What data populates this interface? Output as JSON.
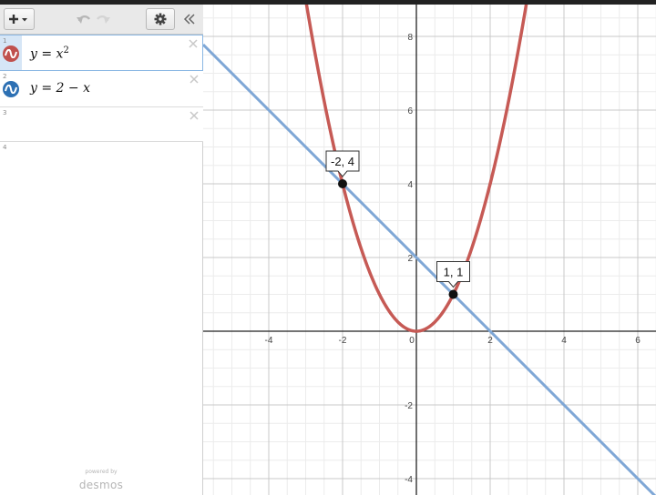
{
  "app": {
    "brand_small": "powered by",
    "brand": "desmos"
  },
  "toolbar": {
    "add_icon": "plus-dropdown-icon",
    "undo_icon": "undo-icon",
    "redo_icon": "redo-icon",
    "settings_icon": "gear-icon",
    "collapse_icon": "double-chevron-left-icon"
  },
  "expressions": [
    {
      "num": "1",
      "color": "#c0504d",
      "lhs": "y = x",
      "sup": "2",
      "active": true
    },
    {
      "num": "2",
      "color": "#2d70b3",
      "lhs": "y = 2 − x",
      "sup": "",
      "active": false
    },
    {
      "num": "3",
      "color": "",
      "lhs": "",
      "sup": "",
      "active": false
    },
    {
      "num": "4",
      "color": "",
      "lhs": "",
      "sup": "",
      "active": false
    }
  ],
  "graph": {
    "x_ticks": [
      "-4",
      "-2",
      "0",
      "2",
      "4",
      "6"
    ],
    "y_ticks": [
      "8",
      "6",
      "4",
      "2",
      "-2",
      "-4"
    ],
    "x_tick_values": [
      -4,
      -2,
      0,
      2,
      4,
      6
    ],
    "y_tick_values": [
      8,
      6,
      4,
      2,
      -2,
      -4
    ],
    "colors": {
      "parabola": "#c65a55",
      "line": "#7fa7d6",
      "axis": "#222222",
      "grid_major": "#c8c8c8",
      "grid_minor": "#ececec"
    },
    "intersections": [
      {
        "x": -2,
        "y": 4,
        "label": "-2, 4"
      },
      {
        "x": 1,
        "y": 1,
        "label": "1, 1"
      }
    ]
  }
}
